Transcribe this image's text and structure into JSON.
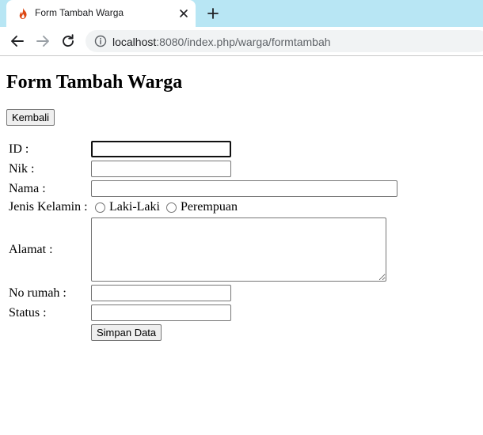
{
  "browser": {
    "tab_title": "Form Tambah Warga",
    "url_host": "localhost",
    "url_rest": ":8080/index.php/warga/formtambah"
  },
  "page": {
    "title": "Form Tambah Warga",
    "back_button": "Kembali",
    "fields": {
      "id_label": "ID :",
      "nik_label": "Nik :",
      "nama_label": "Nama :",
      "gender_label": "Jenis Kelamin :",
      "gender_options": [
        "Laki-Laki",
        "Perempuan"
      ],
      "alamat_label": "Alamat :",
      "no_rumah_label": "No rumah :",
      "status_label": "Status :"
    },
    "submit_button": "Simpan Data"
  }
}
